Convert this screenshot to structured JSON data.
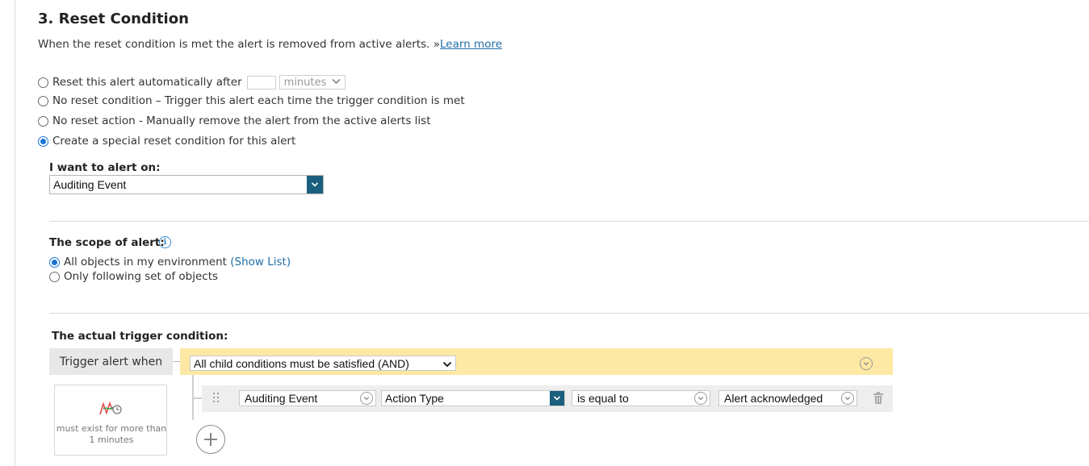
{
  "section": {
    "title": "3. Reset Condition",
    "description": "When the reset condition is met the alert is removed from active alerts. »",
    "learn_more": "Learn more"
  },
  "reset_options": [
    {
      "label": "Reset this alert automatically after",
      "checked": false
    },
    {
      "label": "No reset condition – Trigger this alert each time the trigger condition is met",
      "checked": false
    },
    {
      "label": "No reset action - Manually remove the alert from the active alerts list",
      "checked": false
    },
    {
      "label": "Create a special reset condition for this alert",
      "checked": true
    }
  ],
  "auto_reset": {
    "value": "",
    "unit": "minutes"
  },
  "alert_on": {
    "label": "I want to alert on:",
    "value": "Auditing Event"
  },
  "scope": {
    "label": "The scope of alert:",
    "options": [
      {
        "label": "All objects in my environment",
        "link": "(Show List)",
        "checked": true
      },
      {
        "label": "Only following set of objects",
        "checked": false
      }
    ]
  },
  "trigger": {
    "label": "The actual trigger condition:",
    "when_label": "Trigger alert when",
    "logic": "All child conditions must be satisfied (AND)",
    "condition": {
      "object": "Auditing Event",
      "field": "Action Type",
      "operator": "is equal to",
      "value": "Alert acknowledged"
    },
    "duration": "must exist for more than 1 minutes"
  },
  "colors": {
    "accent_blue": "#1a73d6",
    "select_button": "#1b5f7e",
    "logic_bar": "#fde9a4",
    "link": "#1f6fa8"
  },
  "icons": [
    "info-icon",
    "chevron-down-icon",
    "drag-handle-icon",
    "trash-icon",
    "duration-icon",
    "add-icon"
  ]
}
